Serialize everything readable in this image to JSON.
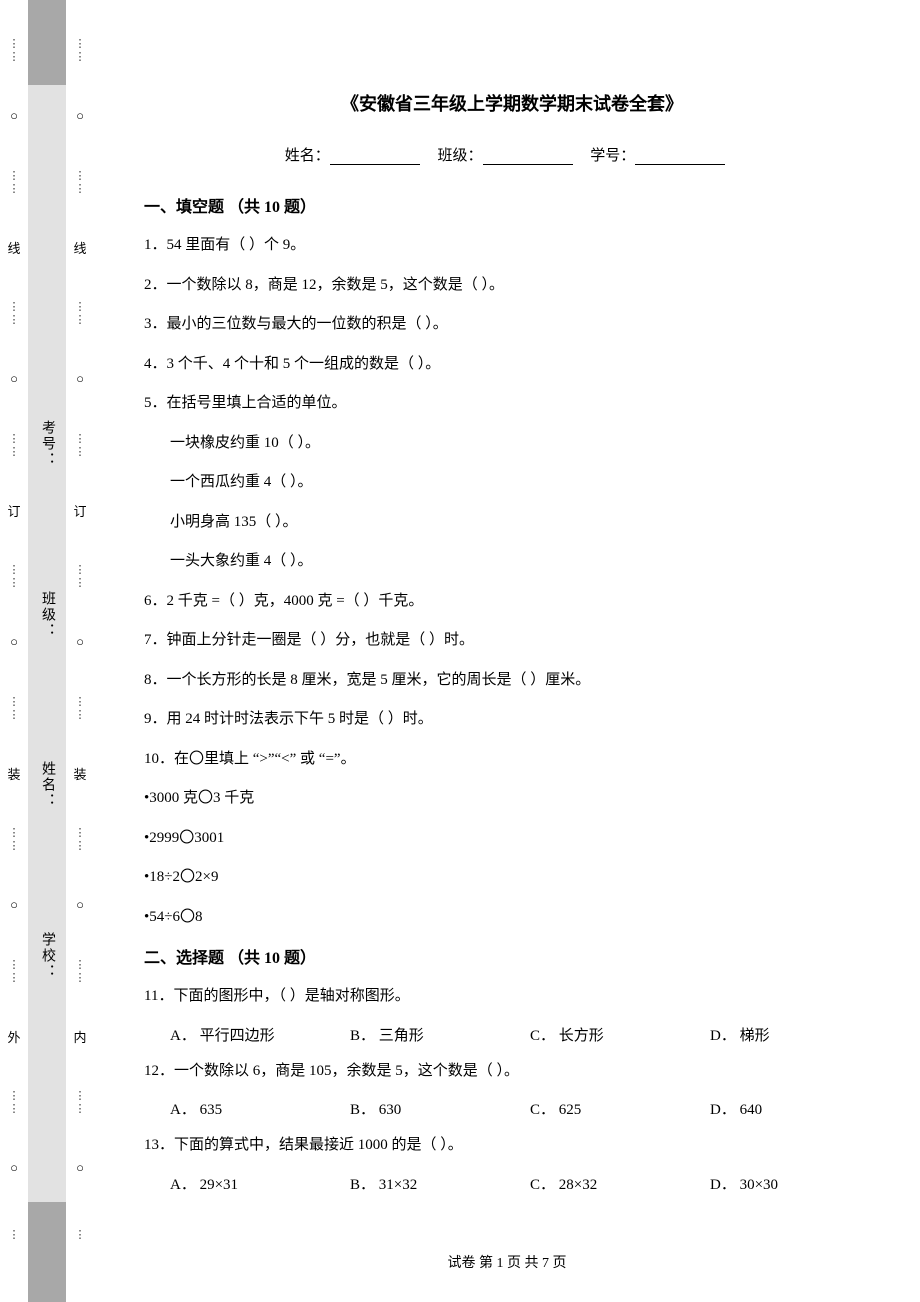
{
  "binding": {
    "outer_markers": [
      "外"
    ],
    "inner_markers": [
      "内"
    ],
    "markers": [
      "线",
      "订",
      "装"
    ],
    "circle_char": "○"
  },
  "gray_labels": {
    "exam_no": "考号：",
    "class": "班级：",
    "name": "姓名：",
    "school": "学校："
  },
  "title": "《安徽省三年级上学期数学期末试卷全套》",
  "info": {
    "name_label": "姓名：",
    "class_label": "班级：",
    "id_label": "学号："
  },
  "section1_title": "一、填空题  （共 10 题）",
  "q1": "1．54 里面有（  ）个 9。",
  "q2": "2．一个数除以 8，商是 12，余数是 5，这个数是（  ）。",
  "q3": "3．最小的三位数与最大的一位数的积是（  ）。",
  "q4": "4．3 个千、4 个十和 5 个一组成的数是（  ）。",
  "q5": "5．在括号里填上合适的单位。",
  "q5_sub": [
    "一块橡皮约重 10（  ）。",
    "一个西瓜约重 4（  ）。",
    "小明身高 135（  ）。",
    "一头大象约重 4（  ）。"
  ],
  "q6": "6．2 千克 =（  ）克，4000 克 =（  ）千克。",
  "q7": "7．钟面上分针走一圈是（  ）分，也就是（  ）时。",
  "q8": "8．一个长方形的长是 8 厘米，宽是 5 厘米，它的周长是（  ）厘米。",
  "q9": "9．用 24 时计时法表示下午 5 时是（  ）时。",
  "q10": "10．在〇里填上 “>”“<” 或 “=”。",
  "q10_sub": [
    "•3000 克〇3 千克",
    "•2999〇3001",
    "•18÷2〇2×9",
    "•54÷6〇8"
  ],
  "section2_title": "二、选择题  （共 10 题）",
  "q11": "11．下面的图形中，（  ）是轴对称图形。",
  "q11_opts": {
    "A": "A．  平行四边形",
    "B": "B．  三角形",
    "C": "C．  长方形",
    "D": "D．  梯形"
  },
  "q12": "12．一个数除以 6，商是 105，余数是 5，这个数是（  ）。",
  "q12_opts": {
    "A": "A．  635",
    "B": "B．  630",
    "C": "C．  625",
    "D": "D．  640"
  },
  "q13": "13．下面的算式中，结果最接近 1000 的是（  ）。",
  "q13_opts": {
    "A": "A．  29×31",
    "B": "B．  31×32",
    "C": "C．  28×32",
    "D": "D．  30×30"
  },
  "footer": "试卷 第 1 页 共 7 页"
}
